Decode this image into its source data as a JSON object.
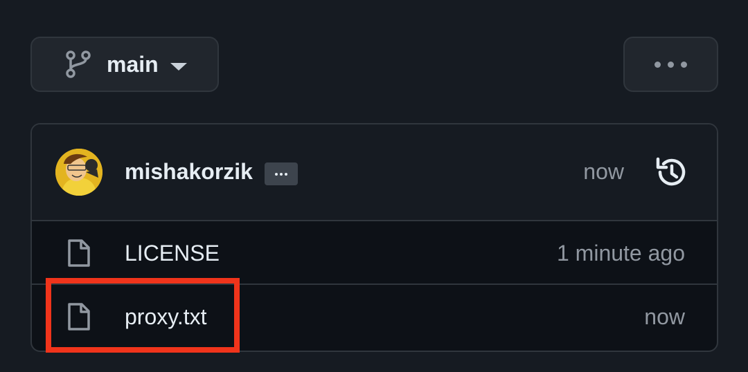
{
  "branch": {
    "name": "main",
    "branch_icon": "git-branch-icon",
    "caret_icon": "triangle-down-icon"
  },
  "more_button": {
    "icon": "kebab-horizontal-icon"
  },
  "latest_commit": {
    "author": "mishakorzik",
    "time": "now",
    "avatar_icon": "user-avatar",
    "history_icon": "history-icon"
  },
  "files": [
    {
      "name": "LICENSE",
      "time": "1 minute ago",
      "icon": "file-icon"
    },
    {
      "name": "proxy.txt",
      "time": "now",
      "icon": "file-icon"
    }
  ],
  "colors": {
    "background": "#161b22",
    "border": "#30363d",
    "text": "#e6edf3",
    "muted": "#9198a1",
    "highlight": "#f0341b"
  }
}
